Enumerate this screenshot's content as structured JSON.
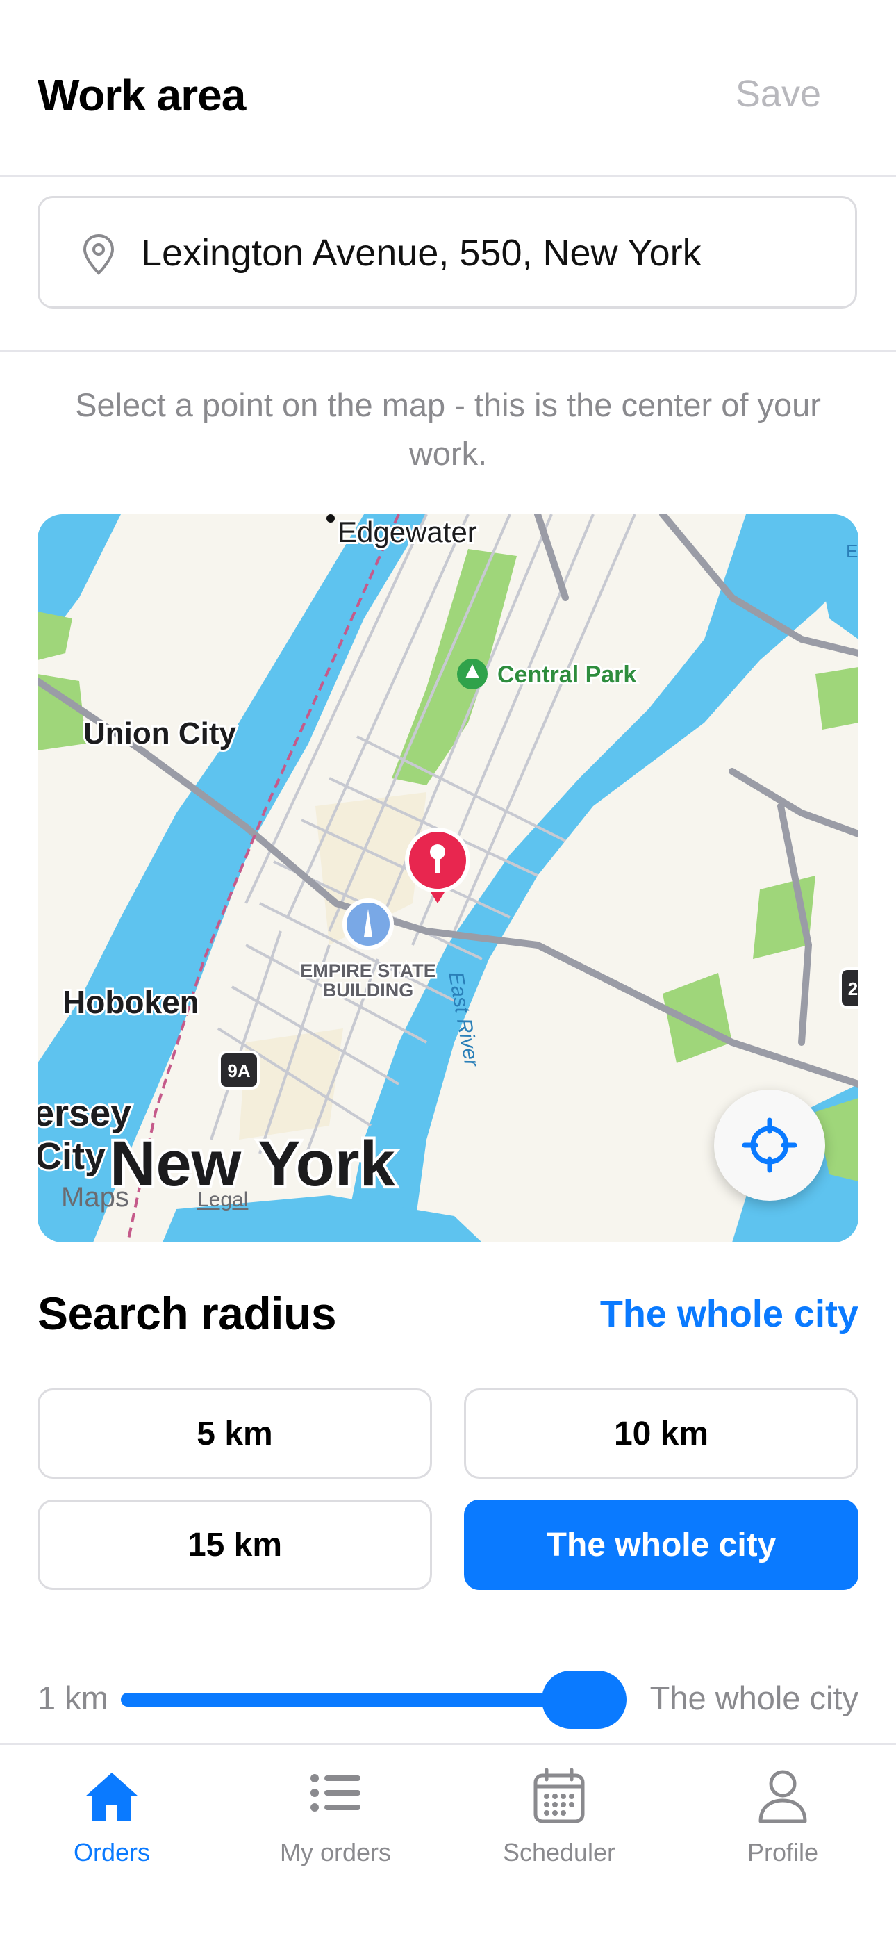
{
  "header": {
    "title": "Work area",
    "save_label": "Save"
  },
  "address": {
    "value": "Lexington Avenue, 550, New York",
    "icon": "location-pin-icon"
  },
  "hint": "Select a point on the map - this is the center of your work.",
  "map": {
    "labels": {
      "edgewater": "Edgewater",
      "central_park": "Central Park",
      "union_city": "Union City",
      "empire_state_1": "EMPIRE STATE",
      "empire_state_2": "BUILDING",
      "east_river": "East River",
      "hoboken": "Hoboken",
      "route_9a": "9A",
      "jersey": "ersey",
      "city": "City",
      "new_york": "New York",
      "maps": "Maps",
      "legal": "Legal",
      "edge_e": "E",
      "edge_2": "2"
    },
    "locate_icon": "crosshair-location-icon"
  },
  "radius": {
    "title": "Search radius",
    "selected": "The whole city",
    "options": [
      {
        "label": "5 km",
        "active": false
      },
      {
        "label": "10 km",
        "active": false
      },
      {
        "label": "15 km",
        "active": false
      },
      {
        "label": "The whole city",
        "active": true
      }
    ]
  },
  "slider": {
    "min_label": "1 km",
    "max_label": "The whole city",
    "value_fraction": 1.0
  },
  "tabs": [
    {
      "label": "Orders",
      "icon": "home-icon",
      "active": true
    },
    {
      "label": "My orders",
      "icon": "list-icon",
      "active": false
    },
    {
      "label": "Scheduler",
      "icon": "calendar-icon",
      "active": false
    },
    {
      "label": "Profile",
      "icon": "person-icon",
      "active": false
    }
  ],
  "colors": {
    "accent": "#0a7aff",
    "pin": "#e8264f",
    "water": "#5ec3ef",
    "park": "#9fd67a"
  }
}
